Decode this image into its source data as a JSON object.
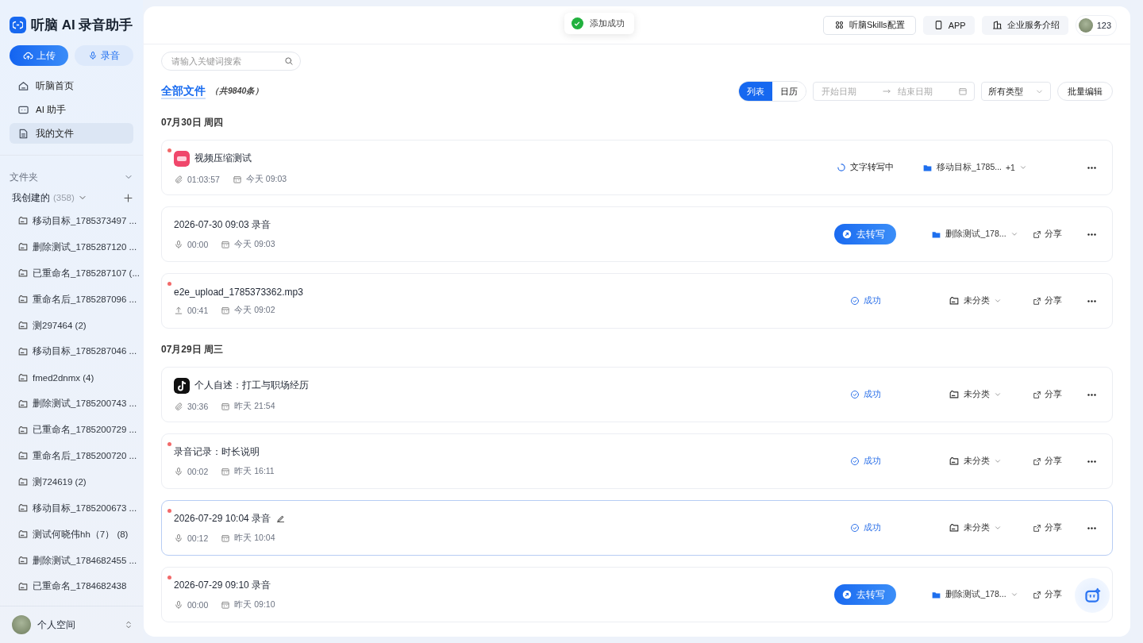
{
  "app": {
    "name": "听脑 AI 录音助手"
  },
  "sidebar": {
    "actions": [
      {
        "label": "上传",
        "kind": "primary"
      },
      {
        "label": "录音",
        "kind": "secondary"
      }
    ],
    "nav": [
      {
        "label": "听脑首页",
        "kind": "home",
        "selected": false
      },
      {
        "label": "AI 助手",
        "kind": "chat",
        "selected": false
      },
      {
        "label": "我的文件",
        "kind": "doc",
        "selected": true
      }
    ],
    "folders_section": {
      "label": "文件夹",
      "expanded": true
    },
    "my_created": {
      "label": "我创建的",
      "count": "(358)",
      "expanded": true
    },
    "folders": [
      "移动目标_1785373497 ...",
      "删除测试_1785287120 ...",
      "已重命名_1785287107 (...",
      "重命名后_1785287096 ...",
      "测297464 (2)",
      "移动目标_1785287046 ...",
      "fmed2dnmx (4)",
      "删除测试_1785200743 ...",
      "已重命名_1785200729 ...",
      "重命名后_1785200720 ...",
      "测724619 (2)",
      "移动目标_1785200673 ...",
      "测试何晓伟hh（7） (8)",
      "删除测试_1784682455 ...",
      "已重命名_1784682438"
    ],
    "footer": {
      "label": "个人空间"
    }
  },
  "toast": {
    "text": "添加成功"
  },
  "header_buttons": [
    {
      "label": "听脑Skills配置",
      "kind": "skills"
    },
    {
      "label": "APP",
      "kind": "phone"
    },
    {
      "label": "企业服务介绍",
      "kind": "building"
    }
  ],
  "user": {
    "label": "123"
  },
  "search": {
    "placeholder": "请输入关键词搜索"
  },
  "title": "全部文件",
  "total": "（共9840条）",
  "view_tabs": [
    {
      "label": "列表",
      "selected": true
    },
    {
      "label": "日历",
      "selected": false
    }
  ],
  "date_range": {
    "start_placeholder": "开始日期",
    "end_placeholder": "结束日期"
  },
  "type_filter": {
    "value": "所有类型"
  },
  "batch_button": "批量编辑",
  "groups": [
    {
      "date": "07月30日 周四",
      "files": [
        {
          "title": "视频压缩测试",
          "source": {
            "kind": "lala"
          },
          "unread": true,
          "selected": false,
          "duration": {
            "kind": "clip",
            "text": "01:03:57"
          },
          "time": "今天 09:03",
          "status": {
            "kind": "transcribing",
            "label": "文字转写中"
          },
          "folder": {
            "kind": "filled",
            "label": "移动目标_1785...",
            "extra": "+1"
          }
        },
        {
          "title": "2026-07-30 09:03 录音",
          "unread": false,
          "selected": false,
          "duration": {
            "kind": "mic",
            "text": "00:00"
          },
          "time": "今天 09:03",
          "status": {
            "kind": "action",
            "label": "去转写"
          },
          "folder": {
            "kind": "filled",
            "label": "删除测试_178..."
          },
          "share": "分享"
        },
        {
          "title": "e2e_upload_1785373362.mp3",
          "unread": true,
          "selected": false,
          "duration": {
            "kind": "upload",
            "text": "00:41"
          },
          "time": "今天 09:02",
          "status": {
            "kind": "success",
            "label": "成功"
          },
          "folder": {
            "kind": "outline",
            "label": "未分类"
          },
          "share": "分享"
        }
      ]
    },
    {
      "date": "07月29日 周三",
      "files": [
        {
          "title": "个人自述：打工与职场经历",
          "source": {
            "kind": "douyin"
          },
          "unread": false,
          "selected": false,
          "duration": {
            "kind": "clip",
            "text": "30:36"
          },
          "time": "昨天 21:54",
          "status": {
            "kind": "success",
            "label": "成功"
          },
          "folder": {
            "kind": "outline",
            "label": "未分类"
          },
          "share": "分享"
        },
        {
          "title": "录音记录：时长说明",
          "unread": true,
          "selected": false,
          "duration": {
            "kind": "mic",
            "text": "00:02"
          },
          "time": "昨天 16:11",
          "status": {
            "kind": "success",
            "label": "成功"
          },
          "folder": {
            "kind": "outline",
            "label": "未分类"
          },
          "share": "分享"
        },
        {
          "title": "2026-07-29 10:04 录音",
          "unread": true,
          "selected": true,
          "duration": {
            "kind": "mic",
            "text": "00:12"
          },
          "time": "昨天 10:04",
          "status": {
            "kind": "success",
            "label": "成功"
          },
          "folder": {
            "kind": "outline",
            "label": "未分类"
          },
          "share": "分享"
        },
        {
          "title": "2026-07-29 09:10 录音",
          "unread": true,
          "selected": false,
          "duration": {
            "kind": "mic",
            "text": "00:00"
          },
          "time": "昨天 09:10",
          "status": {
            "kind": "action",
            "label": "去转写"
          },
          "folder": {
            "kind": "filled",
            "label": "删除测试_178..."
          },
          "share": "分享"
        }
      ]
    }
  ]
}
